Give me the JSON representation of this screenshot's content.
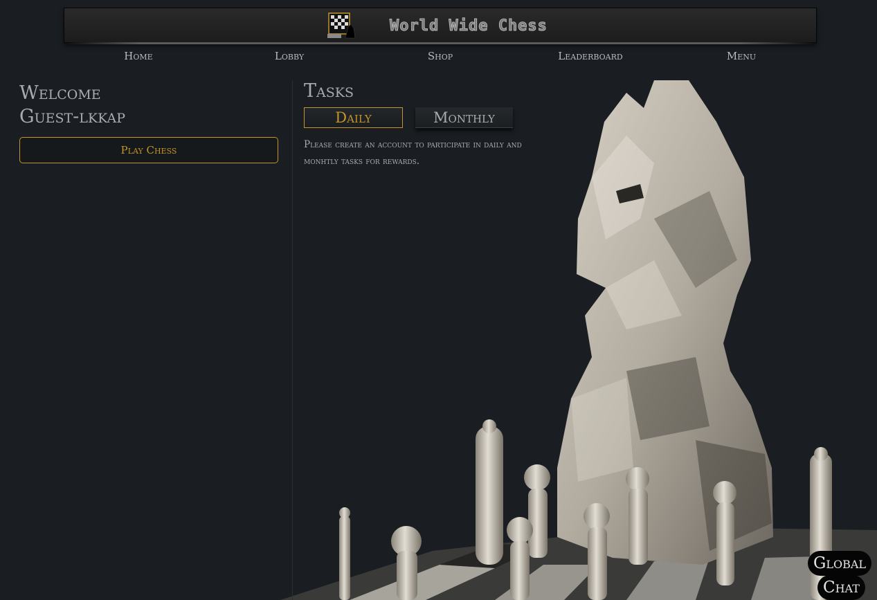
{
  "header": {
    "title": "World Wide Chess",
    "logo_icon": "chessboard-logo-icon"
  },
  "nav": {
    "items": [
      "Home",
      "Lobby",
      "Shop",
      "Leaderboard",
      "Menu"
    ]
  },
  "welcome": {
    "line1": "Welcome",
    "line2": "Guest-lkkap",
    "play_button": "Play Chess"
  },
  "tasks": {
    "title": "Tasks",
    "tabs": [
      "Daily",
      "Monthly"
    ],
    "active_tab": "Daily",
    "message": "Please create an account to participate in daily and monhtly tasks for rewards."
  },
  "chat": {
    "line1": "Global",
    "line2": "Chat"
  },
  "colors": {
    "accent": "#c4952a",
    "background": "#1a1e22",
    "text": "#a8acb0"
  }
}
